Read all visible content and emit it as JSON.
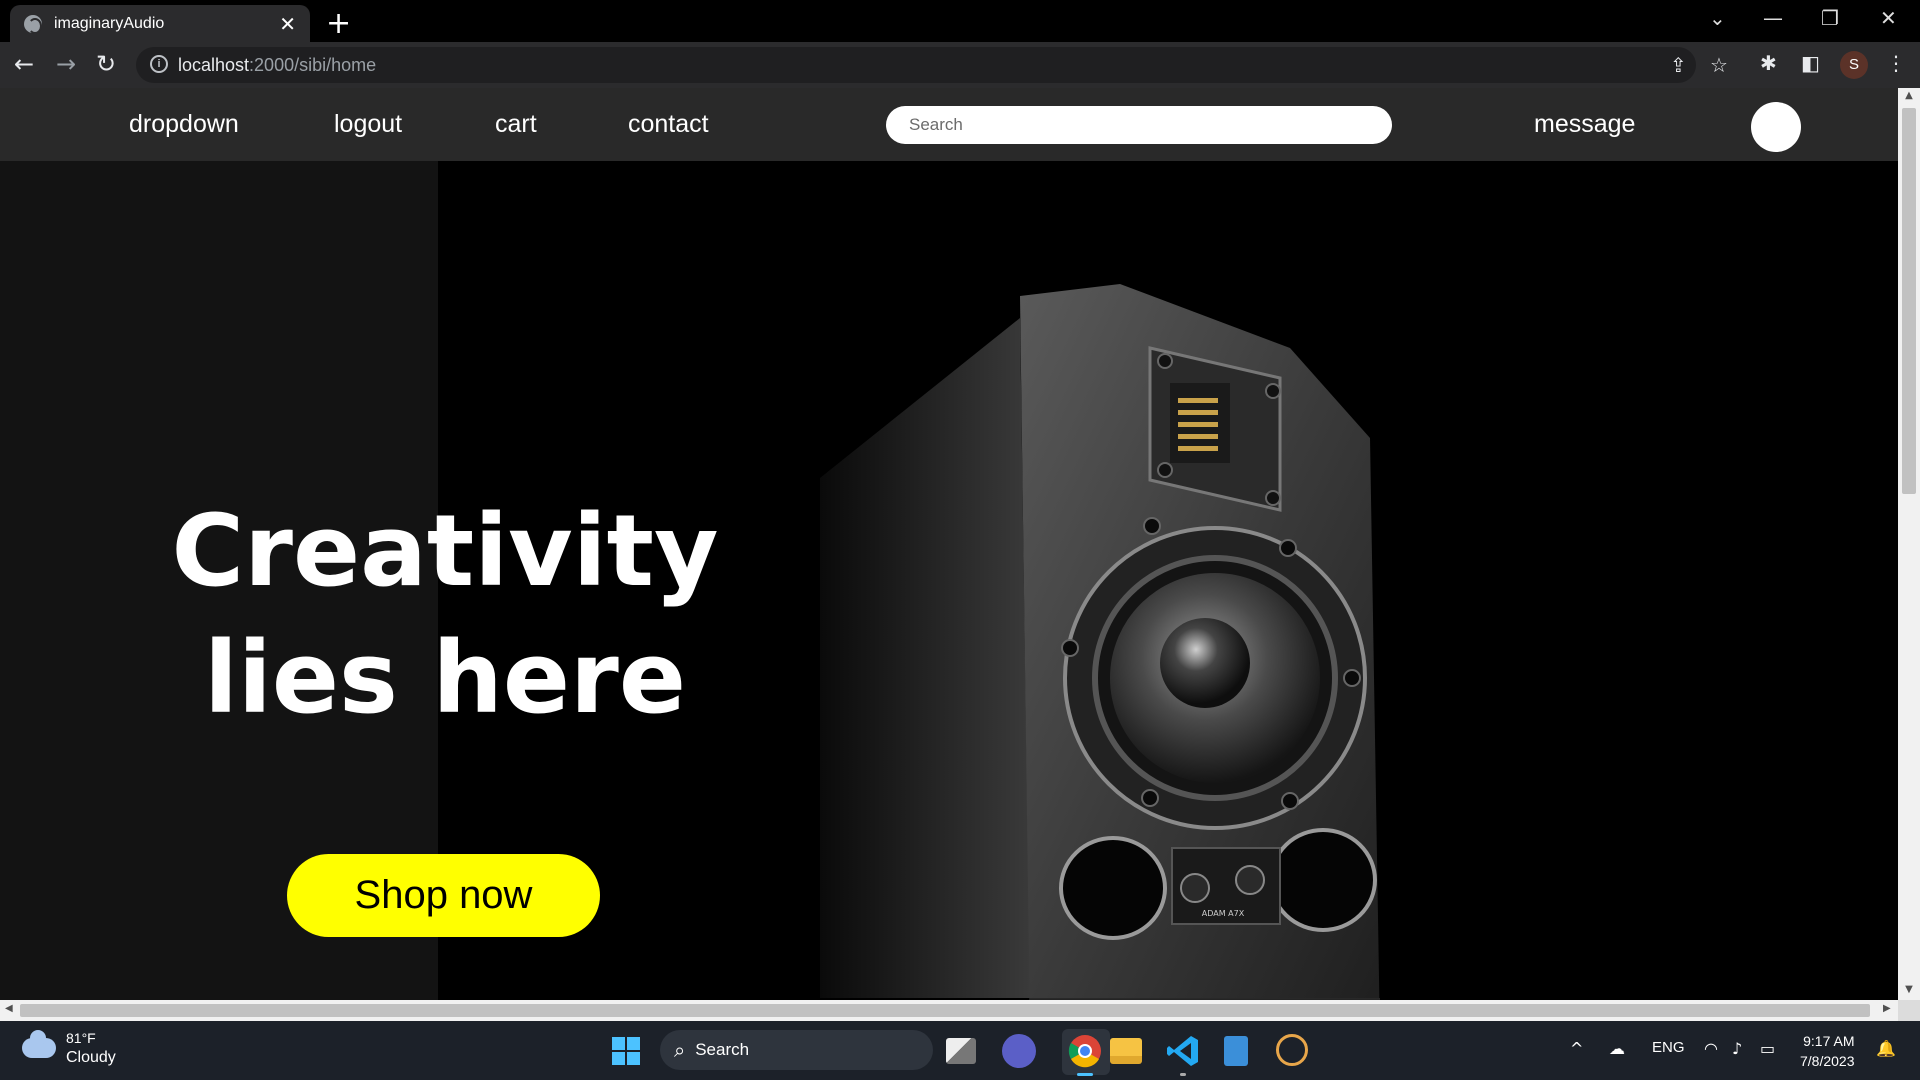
{
  "browser": {
    "tab_title": "imaginaryAudio",
    "tab_close": "✕",
    "new_tab": "+",
    "url_host": "localhost",
    "url_path": ":2000/sibi/home",
    "window_controls": [
      "⌄",
      "—",
      "❐",
      "✕"
    ]
  },
  "site": {
    "nav": {
      "dropdown": "dropdown",
      "logout": "logout",
      "cart": "cart",
      "contact": "contact",
      "message": "message"
    },
    "search": {
      "placeholder": "Search",
      "value": ""
    },
    "hero": {
      "line1": "Creativity",
      "line2": "lies here",
      "cta": "Shop now",
      "cta_color": "#ffff00",
      "product_brand": "ADAM A7X"
    }
  },
  "taskbar": {
    "weather_temp": "81°F",
    "weather_desc": "Cloudy",
    "search_label": "Search",
    "language": "ENG",
    "time": "9:17 AM",
    "date": "7/8/2023"
  },
  "colors": {
    "nav_bg": "#292929",
    "hero_left_bg": "#131313",
    "accent_yellow": "#ffff00",
    "taskbar_bg": "#1c2129"
  }
}
